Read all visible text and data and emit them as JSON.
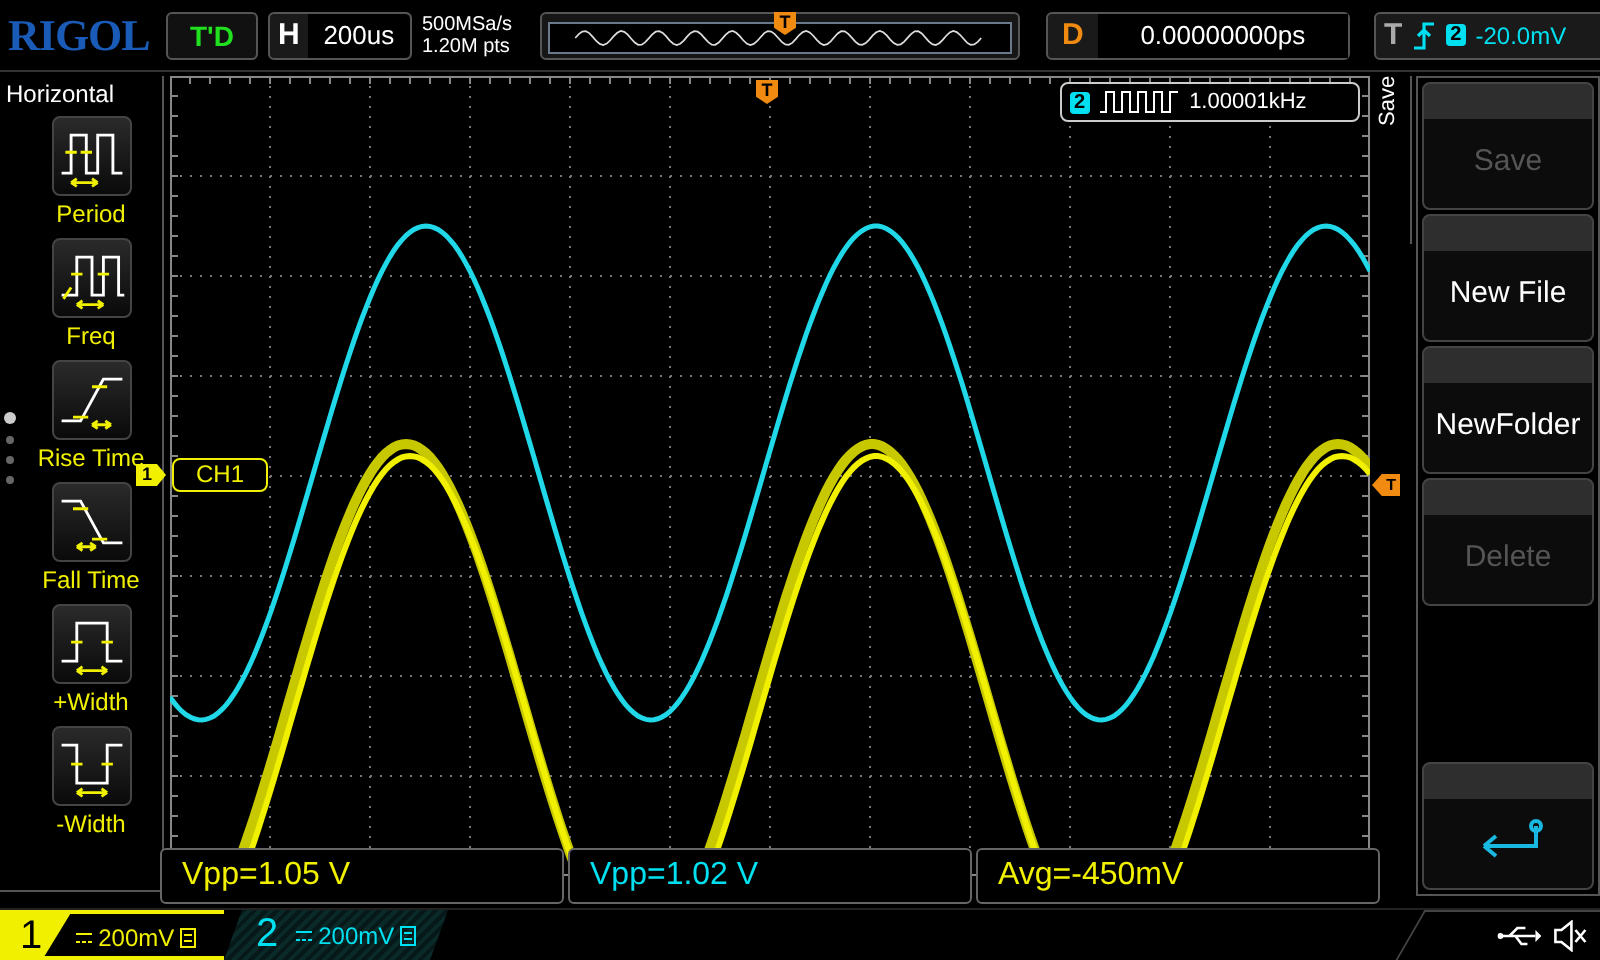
{
  "brand": "RIGOL",
  "run_status": "T'D",
  "timebase": {
    "label": "H",
    "value": "200us"
  },
  "acquisition": {
    "sample_rate": "500MSa/s",
    "memory_depth": "1.20M pts"
  },
  "overview": {
    "trigger_marker": "T"
  },
  "delay": {
    "label": "D",
    "value": "0.00000000ps"
  },
  "trigger": {
    "label": "T",
    "source": "2",
    "level": "-20.0mV"
  },
  "left_menu": {
    "title": "Horizontal",
    "items": [
      {
        "label": "Period",
        "kind": "period"
      },
      {
        "label": "Freq",
        "kind": "freq"
      },
      {
        "label": "Rise Time",
        "kind": "rise"
      },
      {
        "label": "Fall Time",
        "kind": "fall"
      },
      {
        "label": "+Width",
        "kind": "pwidth"
      },
      {
        "label": "-Width",
        "kind": "nwidth"
      }
    ],
    "pages": [
      {
        "selected": true
      },
      {
        "selected": false
      },
      {
        "selected": false
      },
      {
        "selected": false
      }
    ]
  },
  "screen": {
    "trigger_position_marker": "T",
    "trigger_level_marker": "T",
    "channel_marker": {
      "number": "1",
      "label": "CH1"
    },
    "frequency_counter": {
      "source": "2",
      "value": "1.00001kHz"
    }
  },
  "measurements": [
    {
      "text": "Vpp=1.05 V",
      "color": "#f0f000"
    },
    {
      "text": "Vpp=1.02 V",
      "color": "#00e0f0"
    },
    {
      "text": "Avg=-450mV",
      "color": "#f0f000"
    }
  ],
  "right_menu": {
    "title": "Save",
    "buttons": [
      {
        "kind": "text",
        "label": "Save",
        "disabled": true
      },
      {
        "kind": "text",
        "label": "New File",
        "disabled": false
      },
      {
        "kind": "text",
        "label": "NewFolder",
        "disabled": false
      },
      {
        "kind": "text",
        "label": "Delete",
        "disabled": true
      },
      {
        "kind": "blank"
      },
      {
        "kind": "back"
      }
    ]
  },
  "channels": [
    {
      "number": "1",
      "scale": "200mV",
      "selected": true,
      "color": "#f0f000"
    },
    {
      "number": "2",
      "scale": "200mV",
      "selected": false,
      "color": "#00e0f0"
    }
  ]
}
